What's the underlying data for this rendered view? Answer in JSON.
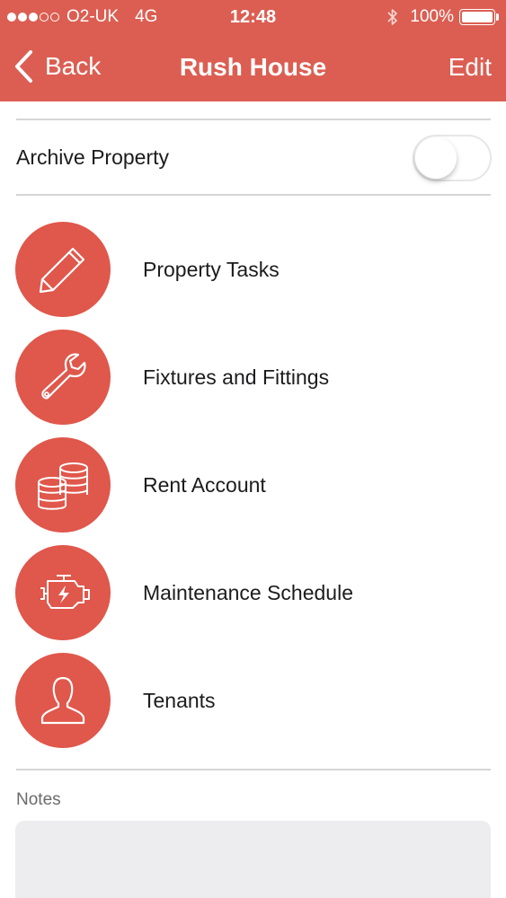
{
  "status_bar": {
    "signal_filled": 3,
    "signal_total": 5,
    "carrier": "O2-UK",
    "network": "4G",
    "time": "12:48",
    "battery": "100%",
    "bluetooth_icon": "bluetooth-icon"
  },
  "nav": {
    "back_label": "Back",
    "title": "Rush House",
    "edit_label": "Edit"
  },
  "archive": {
    "label": "Archive Property",
    "toggle_on": false
  },
  "menu": {
    "items": [
      {
        "label": "Property Tasks",
        "icon": "pencil-icon"
      },
      {
        "label": "Fixtures and Fittings",
        "icon": "wrench-icon"
      },
      {
        "label": "Rent Account",
        "icon": "coins-icon"
      },
      {
        "label": "Maintenance Schedule",
        "icon": "engine-icon"
      },
      {
        "label": "Tenants",
        "icon": "person-icon"
      }
    ]
  },
  "notes": {
    "label": "Notes",
    "value": ""
  },
  "colors": {
    "header": "#dc5e52",
    "icon_circle": "#e0574b",
    "divider": "#d6d6d6"
  }
}
